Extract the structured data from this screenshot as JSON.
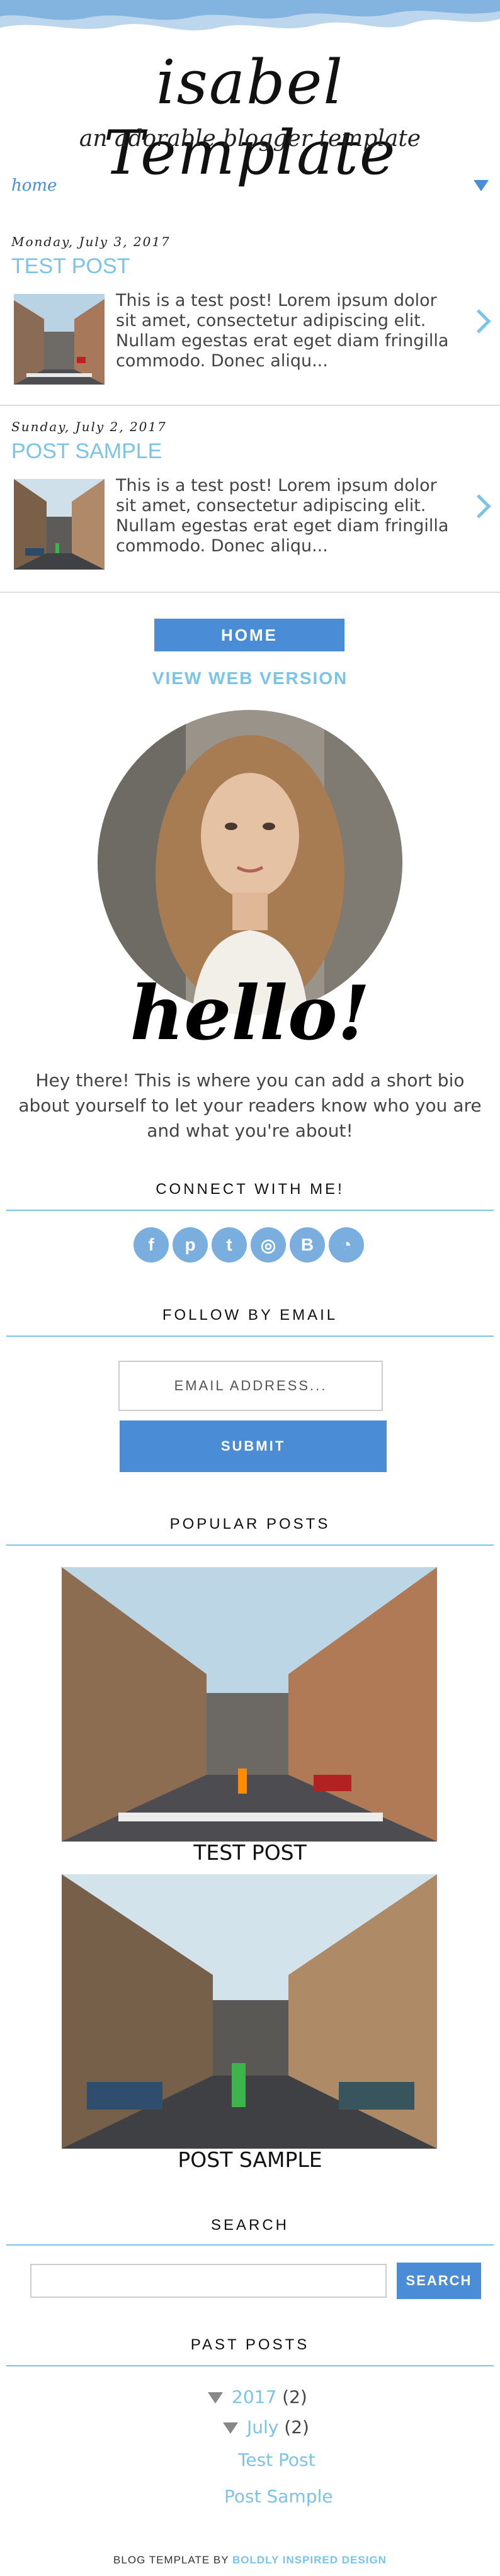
{
  "header": {
    "title": "isabel Template",
    "tagline": "an adorable blogger template"
  },
  "nav": {
    "home_label": "home",
    "caret_icon": "caret-down-icon"
  },
  "posts": [
    {
      "date": "Monday, July 3, 2017",
      "title": "TEST POST",
      "excerpt": "This is a test post! Lorem ipsum dolor sit amet, consectetur adipiscing elit. Nullam egestas erat eget diam fringilla commodo. Donec aliqu..."
    },
    {
      "date": "Sunday, July 2, 2017",
      "title": "POST SAMPLE",
      "excerpt": "This is a test post! Lorem ipsum dolor sit amet, consectetur adipiscing elit. Nullam egestas erat eget diam fringilla commodo. Donec aliqu..."
    }
  ],
  "mobile_nav": {
    "home_button": "HOME",
    "view_web": "VIEW WEB VERSION"
  },
  "about": {
    "hello": "hello!",
    "bio": "Hey there! This is where you can add a short bio about yourself to let your readers know who you are and what you're about!"
  },
  "connect": {
    "title": "CONNECT WITH ME!",
    "icons": [
      "facebook-icon",
      "pinterest-icon",
      "twitter-icon",
      "instagram-icon",
      "bloglovin-icon",
      "rss-icon"
    ]
  },
  "follow": {
    "title": "FOLLOW BY EMAIL",
    "placeholder": "EMAIL ADDRESS...",
    "submit": "SUBMIT"
  },
  "popular": {
    "title": "POPULAR POSTS",
    "items": [
      "TEST POST",
      "POST SAMPLE"
    ]
  },
  "search": {
    "title": "SEARCH",
    "button": "SEARCH"
  },
  "archive": {
    "title": "PAST POSTS",
    "year": "2017",
    "year_count": "(2)",
    "month": "July",
    "month_count": "(2)",
    "posts": [
      "Test Post",
      "Post Sample"
    ]
  },
  "footer": {
    "prefix": "BLOG TEMPLATE BY",
    "brand": "BOLDLY INSPIRED DESIGN"
  },
  "colors": {
    "accent": "#4a8cd6",
    "link": "#7ac4e8"
  }
}
